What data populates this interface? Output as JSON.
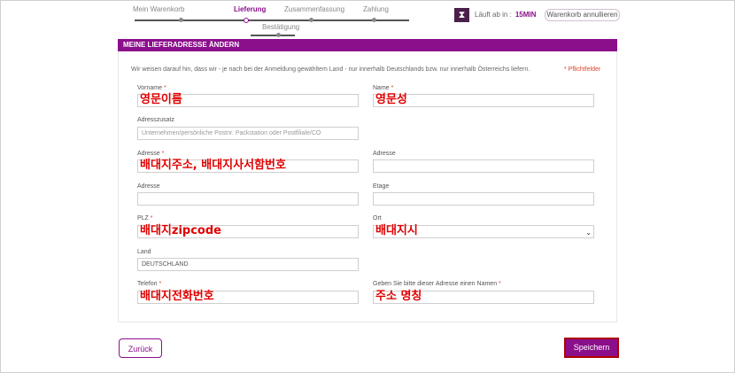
{
  "steps": {
    "items": [
      "Mein Warenkorb",
      "Lieferung",
      "Zusammenfassung",
      "Zahlung"
    ],
    "sub": "Bestätigung"
  },
  "timer": {
    "label": "Läuft ab in :",
    "value": "15MIN",
    "icon": "hourglass-icon"
  },
  "cancel_label": "Warenkorb annullieren",
  "section_title": "MEINE LIEFERADRESSE ÄNDERN",
  "notice": "Wir weisen darauf hin, dass wir - je nach bei der Anmeldung gewähltem Land - nur innerhalb Deutschlands bzw. nur innerhalb Österreichs liefern.",
  "required_note": "* Pflichtfelder",
  "fields": {
    "vorname": {
      "label": "Vorname",
      "req": "*",
      "annotation": "영문이름"
    },
    "name": {
      "label": "Name",
      "req": "*",
      "annotation": "영문성"
    },
    "adresszusatz": {
      "label": "Adresszusatz",
      "placeholder": "Unternehmen/persönliche Postnr. Packstation oder Postfiliale/CO"
    },
    "adresse1": {
      "label": "Adresse",
      "req": "*",
      "annotation": "배대지주소, 배대지사서함번호"
    },
    "adresse_right": {
      "label": "Adresse"
    },
    "adresse2": {
      "label": "Adresse"
    },
    "etage": {
      "label": "Etage"
    },
    "plz": {
      "label": "PLZ",
      "req": "*",
      "annotation": "배대지zipcode"
    },
    "ort": {
      "label": "Ort",
      "annotation": "배대지시"
    },
    "land": {
      "label": "Land",
      "value": "DEUTSCHLAND"
    },
    "telefon": {
      "label": "Telefon",
      "req": "*",
      "annotation": "배대지전화번호"
    },
    "adressname": {
      "label": "Geben Sie bitte dieser Adresse einen Namen",
      "req": "*",
      "annotation": "주소 명칭"
    }
  },
  "buttons": {
    "back": "Zurück",
    "save": "Speichern"
  },
  "colors": {
    "brand": "#8b0e8b",
    "required": "#d9452b",
    "annotation": "#e00000"
  }
}
